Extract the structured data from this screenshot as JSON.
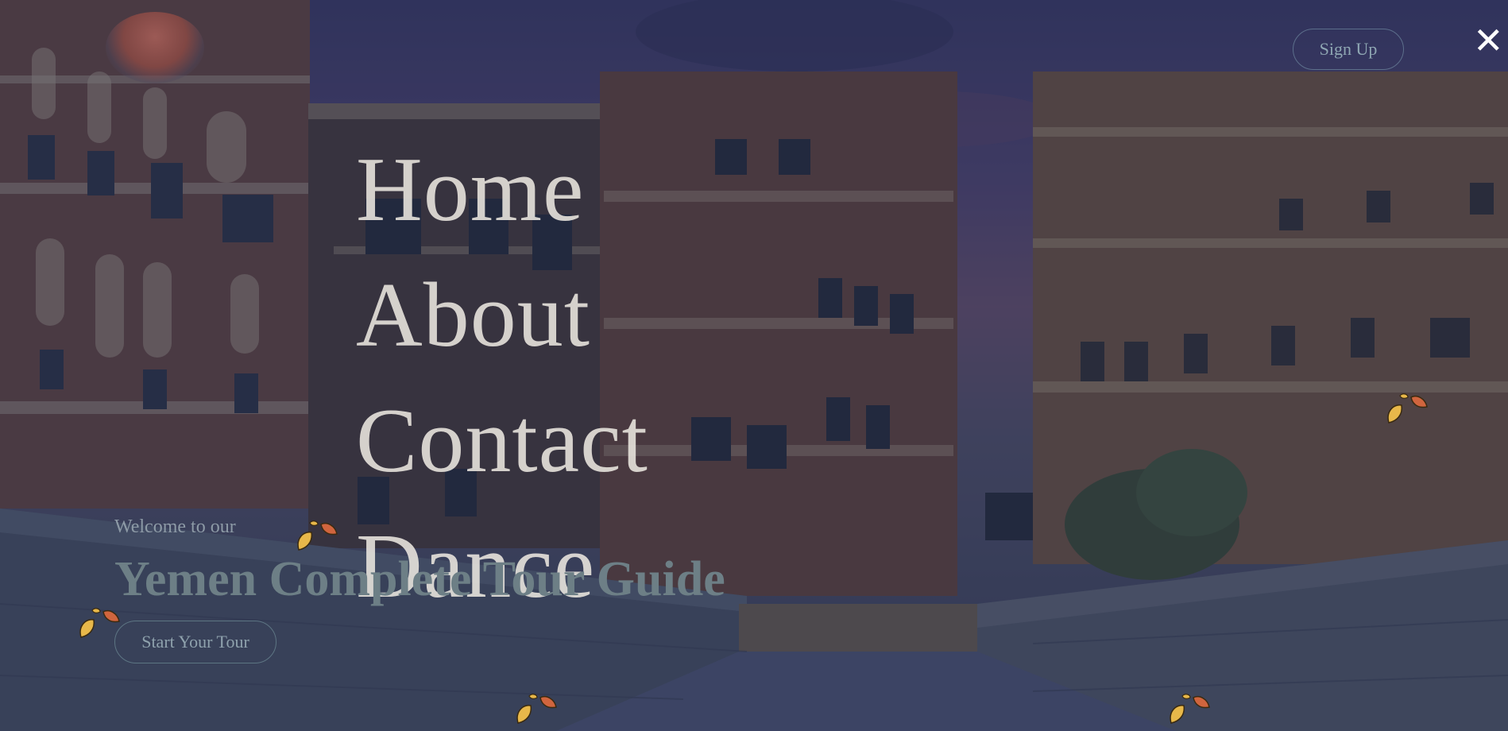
{
  "header": {
    "signup_label": "Sign Up",
    "close_glyph": "✕"
  },
  "menu": {
    "items": [
      {
        "label": "Home"
      },
      {
        "label": "About"
      },
      {
        "label": "Contact"
      },
      {
        "label": "Dance"
      }
    ]
  },
  "hero": {
    "welcome": "Welcome to our",
    "title": "Yemen Complete Tour Guide",
    "cta_label": "Start Your Tour"
  },
  "colors": {
    "overlay": "#282d46",
    "menu_text": "#e7e3dc",
    "button_text": "#8fa7b3",
    "leaf_yellow": "#e8b84a",
    "leaf_red": "#d0653e"
  },
  "icons": [
    "logo-emblem",
    "close-icon",
    "leaf-icon"
  ]
}
